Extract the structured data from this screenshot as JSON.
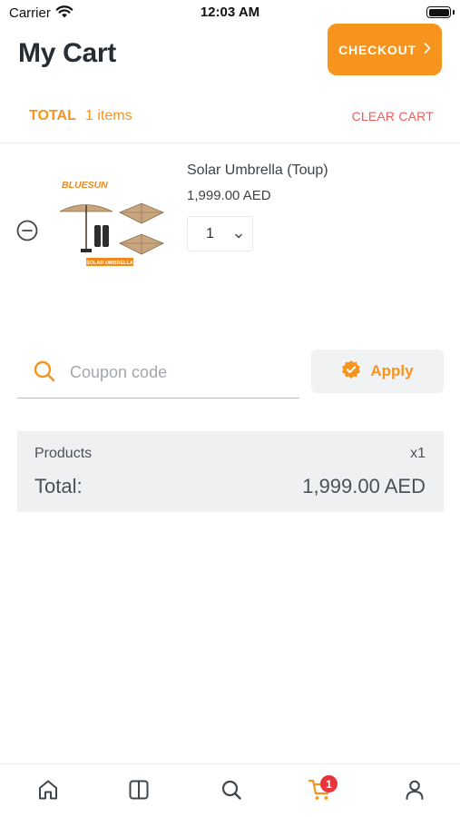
{
  "status_bar": {
    "carrier": "Carrier",
    "time": "12:03 AM"
  },
  "header": {
    "title": "My Cart",
    "checkout_label": "CHECKOUT"
  },
  "summary": {
    "total_label": "TOTAL",
    "items_count": "1 items",
    "clear_label": "CLEAR CART"
  },
  "cart_items": [
    {
      "name": "Solar Umbrella  (Toup)",
      "price": "1,999.00 AED",
      "quantity": "1",
      "image": {
        "brand": "BLUESUN",
        "caption": "SOLAR UMBRELLA"
      }
    }
  ],
  "coupon": {
    "placeholder": "Coupon code",
    "apply_label": "Apply"
  },
  "totals": {
    "products_label": "Products",
    "products_qty": "x1",
    "total_label": "Total:",
    "total_amount": "1,999.00 AED"
  },
  "tab_bar": {
    "items": [
      "home-icon",
      "catalog-icon",
      "search-icon",
      "cart-icon",
      "profile-icon"
    ],
    "active": "cart-icon",
    "cart_badge": "1"
  },
  "colors": {
    "accent": "#f7941d",
    "danger": "#ef5b5b",
    "badge": "#e8333d",
    "panel": "#eef0f2"
  }
}
